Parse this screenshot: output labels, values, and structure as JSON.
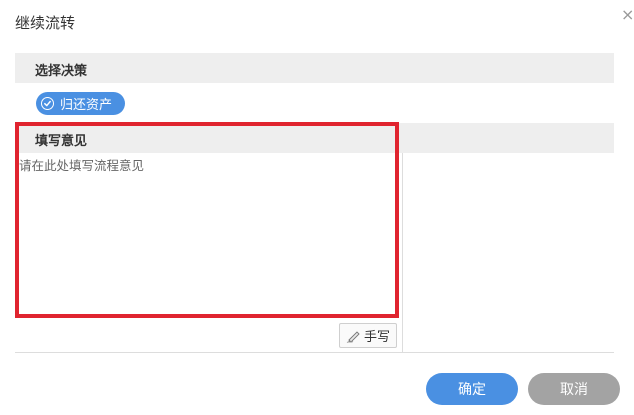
{
  "dialog": {
    "title": "继续流转",
    "close_symbol": "×"
  },
  "decision_section": {
    "header": "选择决策",
    "options": [
      {
        "label": "归还资产",
        "selected": true,
        "icon": "check-circle-icon"
      }
    ]
  },
  "opinion_section": {
    "header": "填写意见",
    "placeholder": "请在此处填写流程意见",
    "value": "",
    "handwrite_label": "手写",
    "handwrite_icon": "pen-icon"
  },
  "footer": {
    "confirm_label": "确定",
    "cancel_label": "取消"
  },
  "colors": {
    "primary": "#4a90e2",
    "secondary": "#a3a3a3",
    "highlight": "#e0242f",
    "header_bg": "#eeeeee"
  }
}
